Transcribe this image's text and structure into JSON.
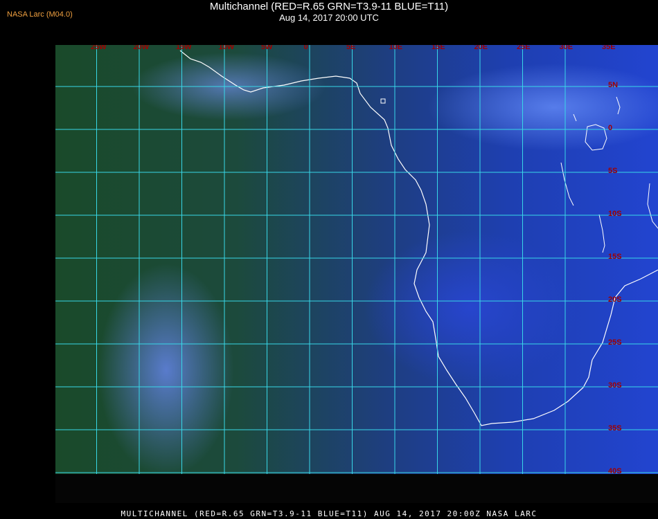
{
  "header": {
    "title": "Multichannel (RED=R.65 GRN=T3.9-11 BLUE=T11)",
    "datetime": "Aug 14, 2017 20:00 UTC",
    "credit": "NASA Larc (M04.0)"
  },
  "map": {
    "lon_labels": [
      "25W",
      "20W",
      "15W",
      "10W",
      "5W",
      "0",
      "5E",
      "10E",
      "15E",
      "20E",
      "25E",
      "30E",
      "35E"
    ],
    "lat_labels": [
      "5N",
      "0",
      "5S",
      "10S",
      "15S",
      "20S",
      "25S",
      "30S",
      "35S",
      "40S"
    ],
    "colors": {
      "grid": "#38d8e8",
      "label": "#a00000",
      "coast": "#ffffff"
    }
  },
  "footer": {
    "text": "MULTICHANNEL (RED=R.65 GRN=T3.9-11 BLUE=T11) AUG 14, 2017 20:00Z  NASA LARC"
  }
}
